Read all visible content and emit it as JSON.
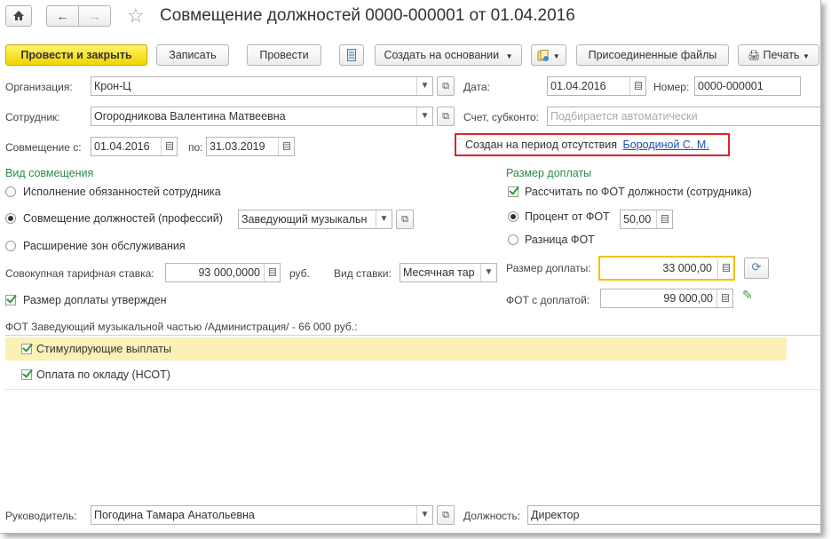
{
  "title": "Совмещение должностей 0000-000001 от 01.04.2016",
  "toolbar": {
    "post_close": "Провести и закрыть",
    "save": "Записать",
    "post": "Провести",
    "create_based": "Создать на основании",
    "attached_files": "Присоединенные файлы",
    "print": "Печать"
  },
  "header": {
    "org_label": "Организация:",
    "org_value": "Крон-Ц",
    "date_label": "Дата:",
    "date_value": "01.04.2016",
    "number_label": "Номер:",
    "number_value": "0000-000001",
    "employee_label": "Сотрудник:",
    "employee_value": "Огородникова Валентина Матвеевна",
    "account_label": "Счет, субконто:",
    "account_placeholder": "Подбирается автоматически",
    "combo_from_label": "Совмещение с:",
    "combo_from_value": "01.04.2016",
    "combo_to_label": "по:",
    "combo_to_value": "31.03.2019",
    "absence_text": "Создан на период отсутствия",
    "absence_link": "Бородиной С. М."
  },
  "vid": {
    "title": "Вид совмещения",
    "options": [
      "Исполнение обязанностей сотрудника",
      "Совмещение должностей (профессий)",
      "Расширение зон обслуживания"
    ],
    "position_value": "Заведующий музыкальн"
  },
  "rate": {
    "label": "Совокупная тарифная ставка:",
    "value": "93 000,0000",
    "unit": "руб.",
    "kind_label": "Вид ставки:",
    "kind_value": "Месячная тар"
  },
  "approved_label": "Размер доплаты утвержден",
  "payment": {
    "title": "Размер доплаты",
    "calc_fot": "Рассчитать по ФОТ должности (сотрудника)",
    "percent_label": "Процент от ФОТ",
    "percent_value": "50,00",
    "diff_label": "Разница ФОТ",
    "amount_label": "Размер доплаты:",
    "amount_value": "33 000,00",
    "fot_with_label": "ФОТ с доплатой:",
    "fot_with_value": "99 000,00"
  },
  "fot_title": "ФОТ Заведующий музыкальной частью /Администрация/ - 66 000 руб.:",
  "fot_rows": [
    "Стимулирующие выплаты",
    "Оплата по окладу (НСОТ)"
  ],
  "footer": {
    "head_label": "Руководитель:",
    "head_value": "Погодина Тамара Анатольевна",
    "position_label": "Должность:",
    "position_value": "Директор"
  }
}
